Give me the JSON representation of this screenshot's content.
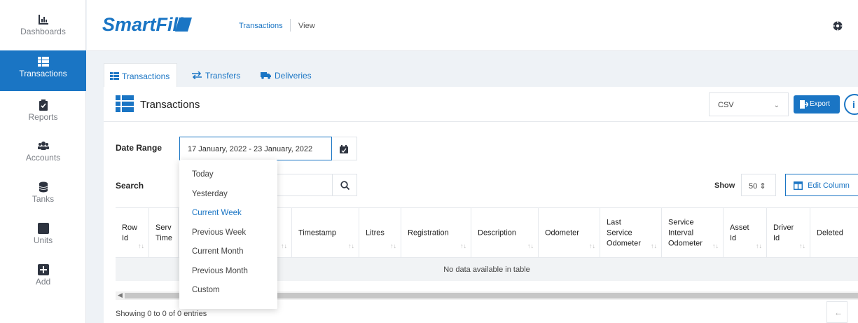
{
  "sidebar": {
    "items": [
      {
        "label": "Dashboards",
        "icon": "bar-chart-icon"
      },
      {
        "label": "Transactions",
        "icon": "table-list-icon",
        "active": true
      },
      {
        "label": "Reports",
        "icon": "clipboard-check-icon"
      },
      {
        "label": "Accounts",
        "icon": "users-icon"
      },
      {
        "label": "Tanks",
        "icon": "database-icon"
      },
      {
        "label": "Units",
        "icon": "square-icon"
      },
      {
        "label": "Add",
        "icon": "plus-square-icon"
      }
    ]
  },
  "header": {
    "logo_text": "SmartFill",
    "breadcrumb": [
      "Transactions",
      "View"
    ]
  },
  "tabs": [
    {
      "label": "Transactions",
      "icon": "table-list-icon"
    },
    {
      "label": "Transfers",
      "icon": "exchange-icon"
    },
    {
      "label": "Deliveries",
      "icon": "truck-icon"
    }
  ],
  "panel": {
    "title": "Transactions",
    "format_select": "CSV",
    "export_label": "Export",
    "info_label": "i"
  },
  "filters": {
    "date_range_label": "Date Range",
    "date_range_value": "17 January, 2022 - 23 January, 2022",
    "search_label": "Search",
    "show_label": "Show",
    "show_value": "50",
    "edit_columns_label": "Edit Column"
  },
  "date_options": [
    "Today",
    "Yesterday",
    "Current Week",
    "Previous Week",
    "Current Month",
    "Previous Month",
    "Custom"
  ],
  "table": {
    "columns": [
      "Row\nId",
      "Serv\nTime",
      "",
      "Timestamp",
      "Litres",
      "Registration",
      "Description",
      "Odometer",
      "Last\nService\nOdometer",
      "Service\nInterval\nOdometer",
      "Asset\nId",
      "Driver\nId",
      "Deleted"
    ],
    "no_data": "No data available in table",
    "info": "Showing 0 to 0 of 0 entries",
    "prev": "←"
  },
  "colors": {
    "accent": "#1a75c4",
    "background": "#eef2f6"
  }
}
